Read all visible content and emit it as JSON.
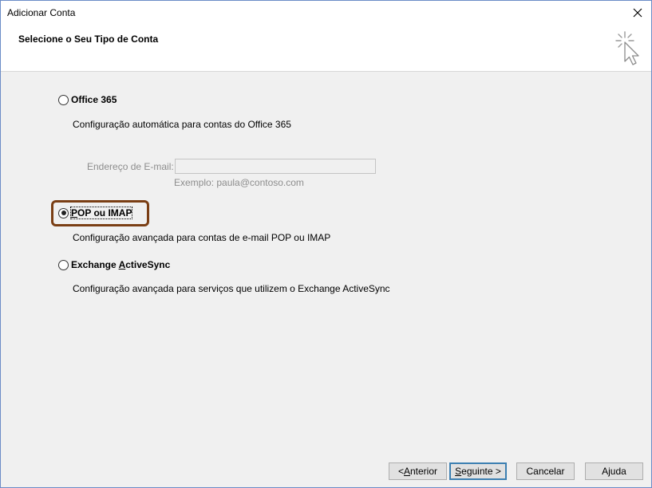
{
  "window": {
    "title": "Adicionar Conta"
  },
  "header": {
    "title": "Selecione o Seu Tipo de Conta"
  },
  "options": {
    "office365": {
      "label": "Office 365",
      "description": "Configuração automática para contas do Office 365",
      "selected": false
    },
    "email": {
      "label": "Endereço de E-mail:",
      "value": "",
      "example": "Exemplo: paula@contoso.com"
    },
    "popimap": {
      "label_pre": "",
      "label_mnemonic": "P",
      "label_post": "OP ou IMAP",
      "description": "Configuração avançada para contas de e-mail POP ou IMAP",
      "selected": true
    },
    "activesync": {
      "label_pre": "Exchange ",
      "label_mnemonic": "A",
      "label_post": "ctiveSync",
      "description": "Configuração avançada para serviços que utilizem o Exchange ActiveSync",
      "selected": false
    }
  },
  "buttons": {
    "back_pre": "< ",
    "back_mnemonic": "A",
    "back_post": "nterior",
    "next_mnemonic": "S",
    "next_post": "eguinte >",
    "cancel": "Cancelar",
    "help": "Ajuda"
  },
  "colors": {
    "highlight": "#7a3e14",
    "window_border": "#6b8cc7",
    "default_button_border": "#3c7fb1"
  }
}
